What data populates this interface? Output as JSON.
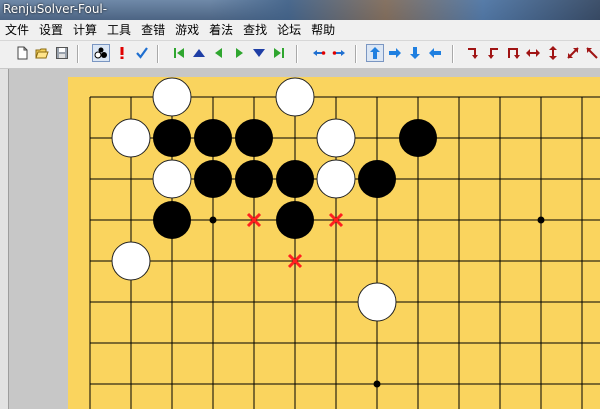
{
  "window": {
    "title": "RenjuSolver-Foul-"
  },
  "menu": [
    "文件",
    "设置",
    "计算",
    "工具",
    "查错",
    "游戏",
    "着法",
    "查找",
    "论坛",
    "帮助"
  ],
  "toolbar_icons": [
    "new-file-icon",
    "open-folder-icon",
    "save-icon",
    "stones-icon",
    "warning-icon",
    "check-icon",
    "first-move-icon",
    "up-icon",
    "previous-move-icon",
    "next-move-icon",
    "down-icon",
    "last-move-icon",
    "shift-left-icon",
    "shift-right-icon",
    "arrow-up-icon",
    "arrow-right-icon",
    "arrow-down-icon",
    "arrow-left-icon",
    "rotate-right-icon",
    "rotate-left-icon",
    "flip-vertical-icon",
    "flip-horizontal-icon",
    "flip-updown-icon",
    "diagonal-icon",
    "anti-diagonal-icon"
  ],
  "colors": {
    "board": "#fad45e",
    "black_stone": "#000000",
    "white_stone": "#ffffff",
    "foul_marker": "#ff2020",
    "nav_icon": "#2fa62f",
    "nav_blue": "#1f3fa6",
    "rotate_icon": "#a01414"
  },
  "board": {
    "black_stones": [
      [
        2,
        1
      ],
      [
        3,
        1
      ],
      [
        4,
        1
      ],
      [
        8,
        1
      ],
      [
        3,
        2
      ],
      [
        4,
        2
      ],
      [
        5,
        2
      ],
      [
        7,
        2
      ],
      [
        2,
        3
      ],
      [
        5,
        3
      ]
    ],
    "white_stones": [
      [
        2,
        0
      ],
      [
        5,
        0
      ],
      [
        1,
        1
      ],
      [
        6,
        1
      ],
      [
        2,
        2
      ],
      [
        6,
        2
      ],
      [
        1,
        4
      ],
      [
        7,
        5
      ]
    ],
    "star_points": [
      [
        3,
        3
      ],
      [
        11,
        3
      ],
      [
        7,
        7
      ]
    ],
    "foul_marks": [
      [
        4,
        3
      ],
      [
        6,
        3
      ],
      [
        5,
        4
      ]
    ]
  }
}
